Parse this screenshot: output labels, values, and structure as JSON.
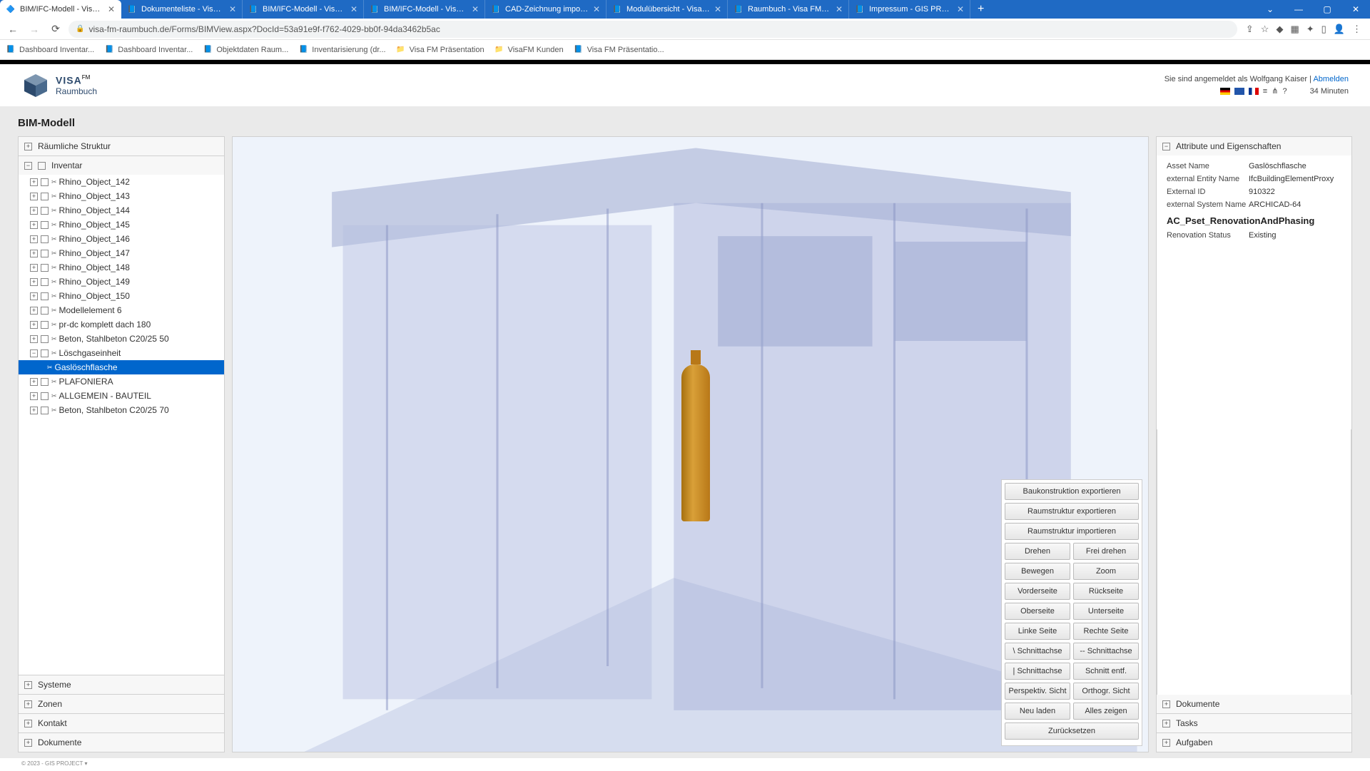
{
  "browser": {
    "tabs": [
      {
        "label": "BIM/IFC-Modell - Visa FM...",
        "active": true
      },
      {
        "label": "Dokumenteliste - Visa FM ...",
        "active": false
      },
      {
        "label": "BIM/IFC-Modell - Visa FM ...",
        "active": false
      },
      {
        "label": "BIM/IFC-Modell - Visa FM ...",
        "active": false
      },
      {
        "label": "CAD-Zeichnung importier...",
        "active": false
      },
      {
        "label": "Modulübersicht - Visa FM...",
        "active": false
      },
      {
        "label": "Raumbuch - Visa FM Raun...",
        "active": false
      },
      {
        "label": "Impressum - GIS PROJECT",
        "active": false
      }
    ],
    "url": "visa-fm-raumbuch.de/Forms/BIMView.aspx?DocId=53a91e9f-f762-4029-bb0f-94da3462b5ac",
    "bookmarks": [
      {
        "label": "Dashboard Inventar...",
        "icon": "stack"
      },
      {
        "label": "Dashboard Inventar...",
        "icon": "stack"
      },
      {
        "label": "Objektdaten Raum...",
        "icon": "stack"
      },
      {
        "label": "Inventarisierung (dr...",
        "icon": "stack"
      },
      {
        "label": "Visa FM Präsentation",
        "icon": "folder"
      },
      {
        "label": "VisaFM Kunden",
        "icon": "folder"
      },
      {
        "label": "Visa FM Präsentatio...",
        "icon": "stack"
      }
    ]
  },
  "header": {
    "logo_main": "VISA",
    "logo_fm": "FM",
    "logo_sub": "Raumbuch",
    "login_text": "Sie sind angemeldet als Wolfgang Kaiser |",
    "logout": "Abmelden",
    "timer": "34 Minuten"
  },
  "page_title": "BIM-Modell",
  "left": {
    "sections": {
      "spatial": "Räumliche Struktur",
      "inventory": "Inventar",
      "systems": "Systeme",
      "zones": "Zonen",
      "contact": "Kontakt",
      "documents": "Dokumente"
    },
    "tree": [
      {
        "label": "Rhino_Object_142",
        "exp": "+"
      },
      {
        "label": "Rhino_Object_143",
        "exp": "+"
      },
      {
        "label": "Rhino_Object_144",
        "exp": "+"
      },
      {
        "label": "Rhino_Object_145",
        "exp": "+"
      },
      {
        "label": "Rhino_Object_146",
        "exp": "+"
      },
      {
        "label": "Rhino_Object_147",
        "exp": "+"
      },
      {
        "label": "Rhino_Object_148",
        "exp": "+"
      },
      {
        "label": "Rhino_Object_149",
        "exp": "+"
      },
      {
        "label": "Rhino_Object_150",
        "exp": "+"
      },
      {
        "label": "Modellelement 6",
        "exp": "+"
      },
      {
        "label": "pr-dc komplett dach 180",
        "exp": "+"
      },
      {
        "label": "Beton, Stahlbeton C20/25 50",
        "exp": "+"
      },
      {
        "label": "Löschgaseinheit",
        "exp": "−",
        "open": true
      },
      {
        "label": "Gaslöschflasche",
        "child": true,
        "selected": true
      },
      {
        "label": "PLAFONIERA",
        "exp": "+"
      },
      {
        "label": "ALLGEMEIN - BAUTEIL",
        "exp": "+"
      },
      {
        "label": "Beton, Stahlbeton C20/25 70",
        "exp": "+"
      }
    ]
  },
  "controls": {
    "full": [
      "Baukonstruktion exportieren",
      "Raumstruktur exportieren",
      "Raumstruktur importieren"
    ],
    "pairs": [
      [
        "Drehen",
        "Frei drehen"
      ],
      [
        "Bewegen",
        "Zoom"
      ],
      [
        "Vorderseite",
        "Rückseite"
      ],
      [
        "Oberseite",
        "Unterseite"
      ],
      [
        "Linke Seite",
        "Rechte Seite"
      ],
      [
        "\\ Schnittachse",
        "-- Schnittachse"
      ],
      [
        "| Schnittachse",
        "Schnitt entf."
      ],
      [
        "Perspektiv. Sicht",
        "Orthogr. Sicht"
      ],
      [
        "Neu laden",
        "Alles zeigen"
      ]
    ],
    "reset": "Zurücksetzen"
  },
  "right": {
    "attr_header": "Attribute und Eigenschaften",
    "props": [
      {
        "k": "Asset Name",
        "v": "Gaslöschflasche"
      },
      {
        "k": "external Entity Name",
        "v": "IfcBuildingElementProxy"
      },
      {
        "k": "External ID",
        "v": "910322"
      },
      {
        "k": "external System Name",
        "v": "ARCHICAD-64"
      }
    ],
    "group": "AC_Pset_RenovationAndPhasing",
    "group_props": [
      {
        "k": "Renovation Status",
        "v": "Existing"
      }
    ],
    "panels": [
      "Dokumente",
      "Tasks",
      "Aufgaben"
    ]
  },
  "footer": "© 2023 - GIS PROJECT ▾"
}
